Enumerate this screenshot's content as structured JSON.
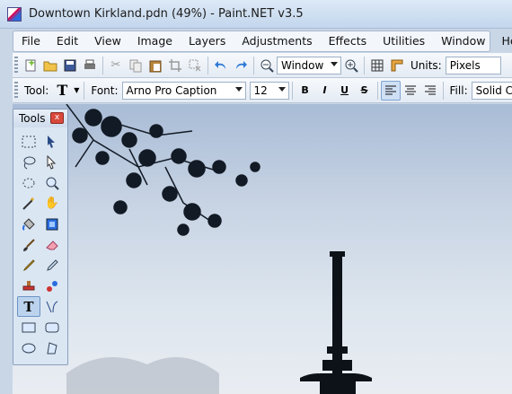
{
  "window": {
    "title": "Downtown Kirkland.pdn (49%) - Paint.NET v3.5"
  },
  "menu": [
    "File",
    "Edit",
    "View",
    "Image",
    "Layers",
    "Adjustments",
    "Effects",
    "Utilities",
    "Window",
    "Help"
  ],
  "toolbar1": {
    "zoom_value": "Window",
    "units_label": "Units:",
    "units_value": "Pixels"
  },
  "toolbar2": {
    "tool_label": "Tool:",
    "font_label": "Font:",
    "font_value": "Arno Pro Caption",
    "size_value": "12",
    "bold": "B",
    "italic": "I",
    "underline": "U",
    "strike": "S",
    "fill_label": "Fill:",
    "fill_value": "Solid Co"
  },
  "tools_panel": {
    "title": "Tools",
    "close": "x"
  },
  "colors": {
    "accent": "#2a6ce0",
    "close_red": "#d9493b"
  }
}
